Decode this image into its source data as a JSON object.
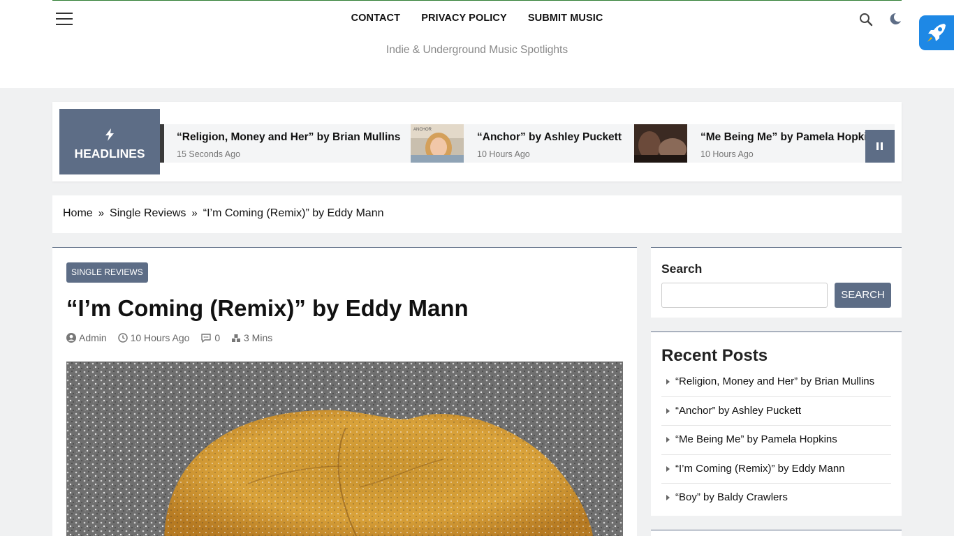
{
  "header": {
    "nav": [
      "CONTACT",
      "PRIVACY POLICY",
      "SUBMIT MUSIC"
    ],
    "tagline": "Indie & Underground Music Spotlights"
  },
  "ticker": {
    "label": "HEADLINES",
    "items": [
      {
        "title": "“Religion, Money and Her” by Brian Mullins",
        "time": "15 Seconds Ago"
      },
      {
        "title": "“Anchor” by Ashley Puckett",
        "time": "10 Hours Ago",
        "thumb_text": "ANCHOR"
      },
      {
        "title": "“Me Being Me” by Pamela Hopkins",
        "time": "10 Hours Ago"
      }
    ]
  },
  "breadcrumb": {
    "items": [
      "Home",
      "Single Reviews",
      "“I’m Coming (Remix)” by Eddy Mann"
    ]
  },
  "post": {
    "category": "SINGLE REVIEWS",
    "title": "“I’m Coming (Remix)” by Eddy Mann",
    "author": "Admin",
    "time": "10 Hours Ago",
    "comments": "0",
    "read_time": "3 Mins"
  },
  "sidebar": {
    "search_title": "Search",
    "search_button": "SEARCH",
    "search_placeholder": "",
    "recent_title": "Recent Posts",
    "recent_posts": [
      "“Religion, Money and Her” by Brian Mullins",
      "“Anchor” by Ashley Puckett",
      "“Me Being Me” by Pamela Hopkins",
      "“I’m Coming (Remix)” by Eddy Mann",
      "“Boy” by Baldy Crawlers"
    ]
  },
  "colors": {
    "accent": "#5d6d86",
    "top_line": "#2e7d32",
    "rocket": "#1e88e5"
  },
  "icons": [
    "menu-icon",
    "search-icon",
    "moon-icon",
    "rocket-icon",
    "bolt-icon",
    "pause-icon",
    "user-icon",
    "clock-icon",
    "comment-icon",
    "read-time-icon",
    "caret-right-icon"
  ]
}
